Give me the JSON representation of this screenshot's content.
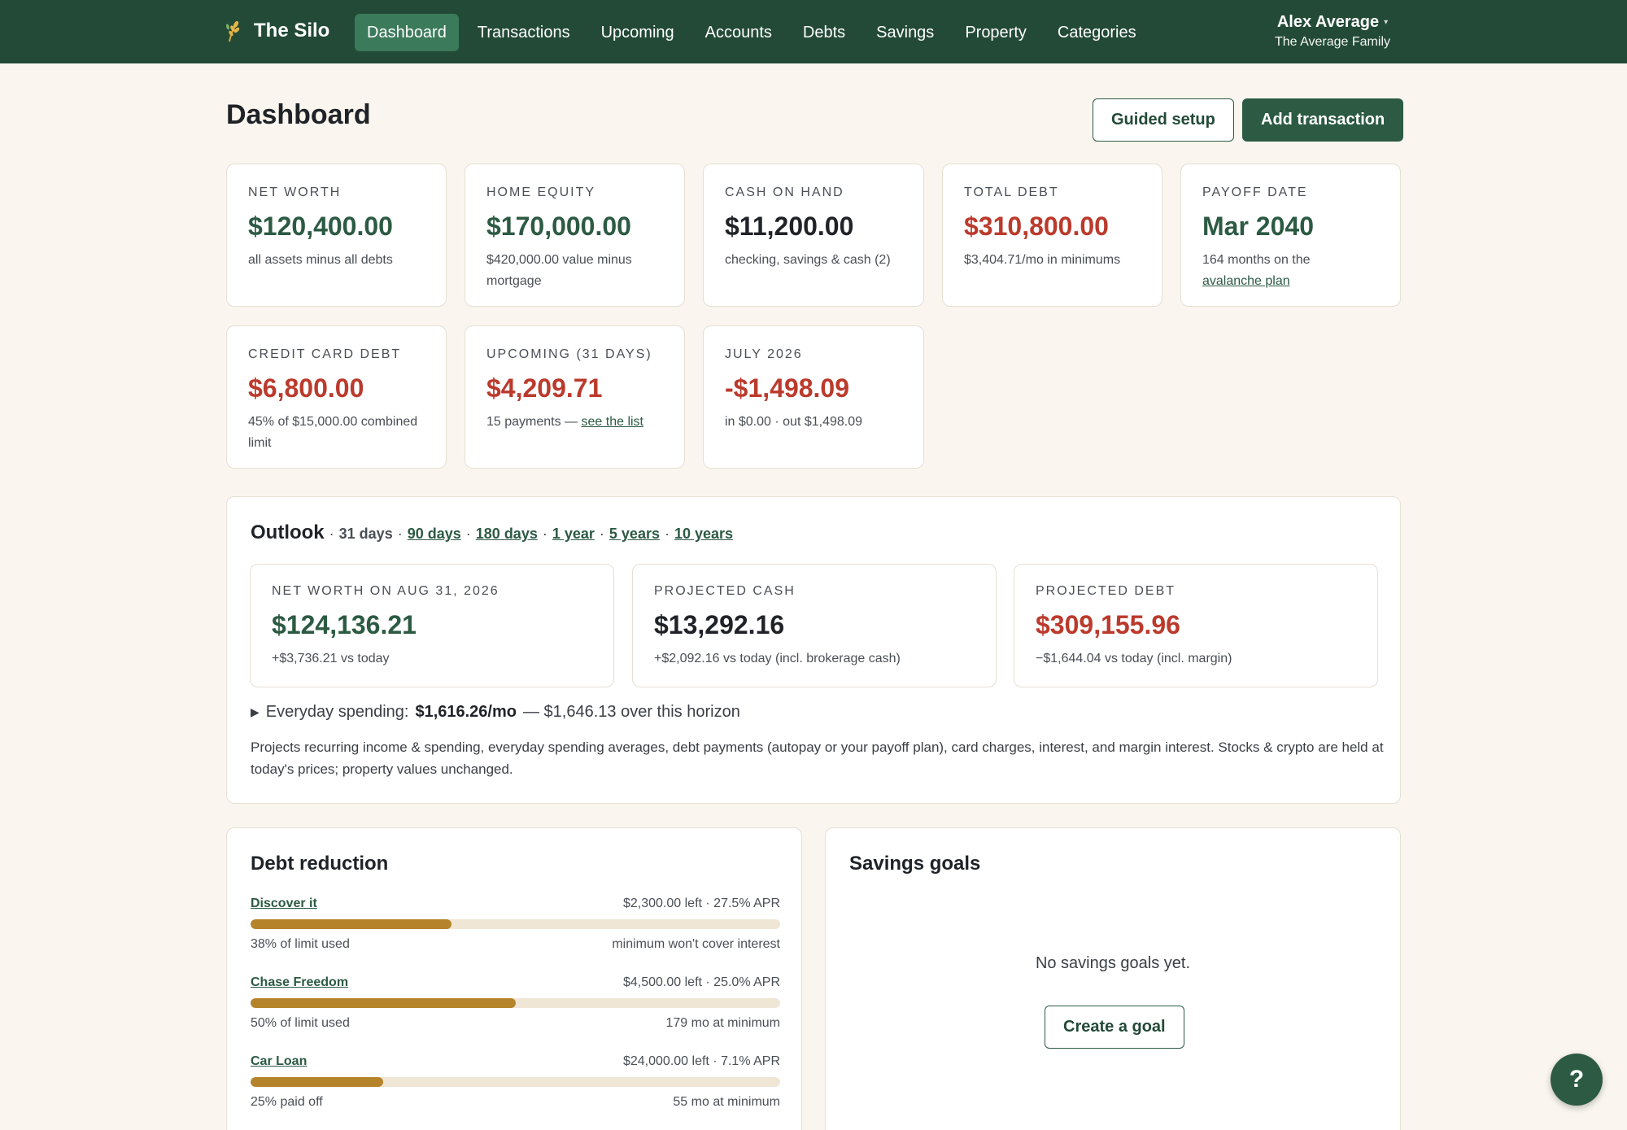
{
  "app": {
    "name": "The Silo",
    "logo_icon": "wheat-icon"
  },
  "nav": {
    "items": [
      {
        "label": "Dashboard",
        "active": true
      },
      {
        "label": "Transactions"
      },
      {
        "label": "Upcoming"
      },
      {
        "label": "Accounts"
      },
      {
        "label": "Debts"
      },
      {
        "label": "Savings"
      },
      {
        "label": "Property"
      },
      {
        "label": "Categories"
      }
    ]
  },
  "user": {
    "name": "Alex Average",
    "caret": "▾",
    "family": "The Average Family"
  },
  "page": {
    "title": "Dashboard"
  },
  "actions": {
    "guided_setup": "Guided setup",
    "add_transaction": "Add transaction"
  },
  "stats": {
    "net_worth": {
      "label": "NET WORTH",
      "value": "$120,400.00",
      "sub": "all assets minus all debts"
    },
    "home_equity": {
      "label": "HOME EQUITY",
      "value": "$170,000.00",
      "sub": "$420,000.00 value minus mortgage"
    },
    "cash_on_hand": {
      "label": "CASH ON HAND",
      "value": "$11,200.00",
      "sub": "checking, savings & cash (2)"
    },
    "total_debt": {
      "label": "TOTAL DEBT",
      "value": "$310,800.00",
      "sub": "$3,404.71/mo in minimums"
    },
    "payoff_date": {
      "label": "PAYOFF DATE",
      "value": "Mar 2040",
      "sub": "164 months on the",
      "link": "avalanche plan"
    },
    "credit_card_debt": {
      "label": "CREDIT CARD DEBT",
      "value": "$6,800.00",
      "sub": "45% of $15,000.00 combined limit"
    },
    "upcoming": {
      "label": "UPCOMING (31 DAYS)",
      "value": "$4,209.71",
      "sub": "15 payments —",
      "link": "see the list"
    },
    "month": {
      "label": "JULY 2026",
      "value": "-$1,498.09",
      "sub": "in $0.00 · out $1,498.09"
    }
  },
  "outlook": {
    "title": "Outlook",
    "sep": "·",
    "current": "31 days",
    "ranges": [
      "90 days",
      "180 days",
      "1 year",
      "5 years",
      "10 years"
    ],
    "net_worth": {
      "label": "NET WORTH ON AUG 31, 2026",
      "value": "$124,136.21",
      "sub": "+$3,736.21 vs today"
    },
    "cash": {
      "label": "PROJECTED CASH",
      "value": "$13,292.16",
      "sub": "+$2,092.16 vs today (incl. brokerage cash)"
    },
    "debt": {
      "label": "PROJECTED DEBT",
      "value": "$309,155.96",
      "sub": "−$1,644.04 vs today (incl. margin)"
    },
    "everyday": {
      "toggle": "▶",
      "prefix": "Everyday spending:",
      "amount": "$1,616.26/mo",
      "suffix": "— $1,646.13 over this horizon"
    },
    "note": "Projects recurring income & spending, everyday spending averages, debt payments (autopay or your payoff plan), card charges, interest, and margin interest. Stocks & crypto are held at today's prices; property values unchanged."
  },
  "debt_reduction": {
    "title": "Debt reduction",
    "items": [
      {
        "name": "Discover it",
        "right": "$2,300.00 left · 27.5% APR",
        "progress": 0.38,
        "left_note": "38% of limit used",
        "right_note": "minimum won't cover interest"
      },
      {
        "name": "Chase Freedom",
        "right": "$4,500.00 left · 25.0% APR",
        "progress": 0.5,
        "left_note": "50% of limit used",
        "right_note": "179 mo at minimum"
      },
      {
        "name": "Car Loan",
        "right": "$24,000.00 left · 7.1% APR",
        "progress": 0.25,
        "left_note": "25% paid off",
        "right_note": "55 mo at minimum"
      }
    ]
  },
  "savings_goals": {
    "title": "Savings goals",
    "empty": "No savings goals yet.",
    "create": "Create a goal"
  },
  "help": {
    "label": "?",
    "icon": "help-icon"
  },
  "colors": {
    "nav_bg": "#234a37",
    "accent": "#2c5a43",
    "positive": "#2c5a43",
    "negative": "#bb3a2c",
    "progress": "#b5832a"
  }
}
